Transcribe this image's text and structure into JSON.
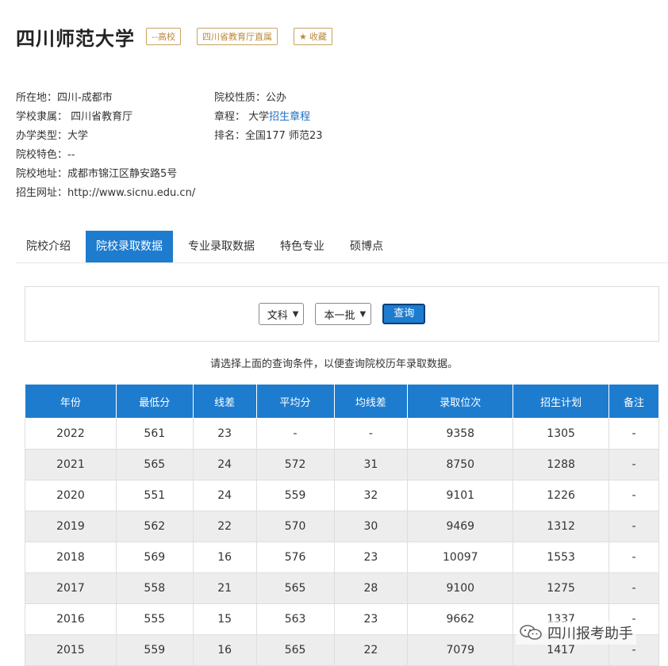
{
  "header": {
    "title": "四川师范大学",
    "tags": [
      "--高校",
      "四川省教育厅直属"
    ],
    "favorite_label": "收藏"
  },
  "info": {
    "location": "所在地：四川-成都市",
    "affiliation": "学校隶属：  四川省教育厅",
    "type": "办学类型：大学",
    "feature": "院校特色：--",
    "address": "院校地址：成都市锦江区静安路5号",
    "website": "招生网址：http://www.sicnu.edu.cn/",
    "nature": "院校性质：公办",
    "charter_prefix": "章程：  大学",
    "charter_link": "招生章程",
    "ranking": "排名：全国177 师范23"
  },
  "tabs": [
    {
      "label": "院校介绍",
      "active": false
    },
    {
      "label": "院校录取数据",
      "active": true
    },
    {
      "label": "专业录取数据",
      "active": false
    },
    {
      "label": "特色专业",
      "active": false
    },
    {
      "label": "硕博点",
      "active": false
    }
  ],
  "query": {
    "subject_selected": "文科",
    "batch_selected": "本一批",
    "button_label": "查询",
    "hint": "请选择上面的查询条件，以便查询院校历年录取数据。"
  },
  "table": {
    "headers": [
      "年份",
      "最低分",
      "线差",
      "平均分",
      "均线差",
      "录取位次",
      "招生计划",
      "备注"
    ],
    "rows": [
      [
        "2022",
        "561",
        "23",
        "-",
        "-",
        "9358",
        "1305",
        "-"
      ],
      [
        "2021",
        "565",
        "24",
        "572",
        "31",
        "8750",
        "1288",
        "-"
      ],
      [
        "2020",
        "551",
        "24",
        "559",
        "32",
        "9101",
        "1226",
        "-"
      ],
      [
        "2019",
        "562",
        "22",
        "570",
        "30",
        "9469",
        "1312",
        "-"
      ],
      [
        "2018",
        "569",
        "16",
        "576",
        "23",
        "10097",
        "1553",
        "-"
      ],
      [
        "2017",
        "558",
        "21",
        "565",
        "28",
        "9100",
        "1275",
        "-"
      ],
      [
        "2016",
        "555",
        "15",
        "563",
        "23",
        "9662",
        "1337",
        "-"
      ],
      [
        "2015",
        "559",
        "16",
        "565",
        "22",
        "7079",
        "1417",
        "-"
      ]
    ]
  },
  "watermark": {
    "text": "四川报考助手"
  },
  "colors": {
    "primary": "#1e7ccf",
    "tag": "#b88a3c",
    "link": "#1e6fc4",
    "alt_row": "#ededed"
  }
}
